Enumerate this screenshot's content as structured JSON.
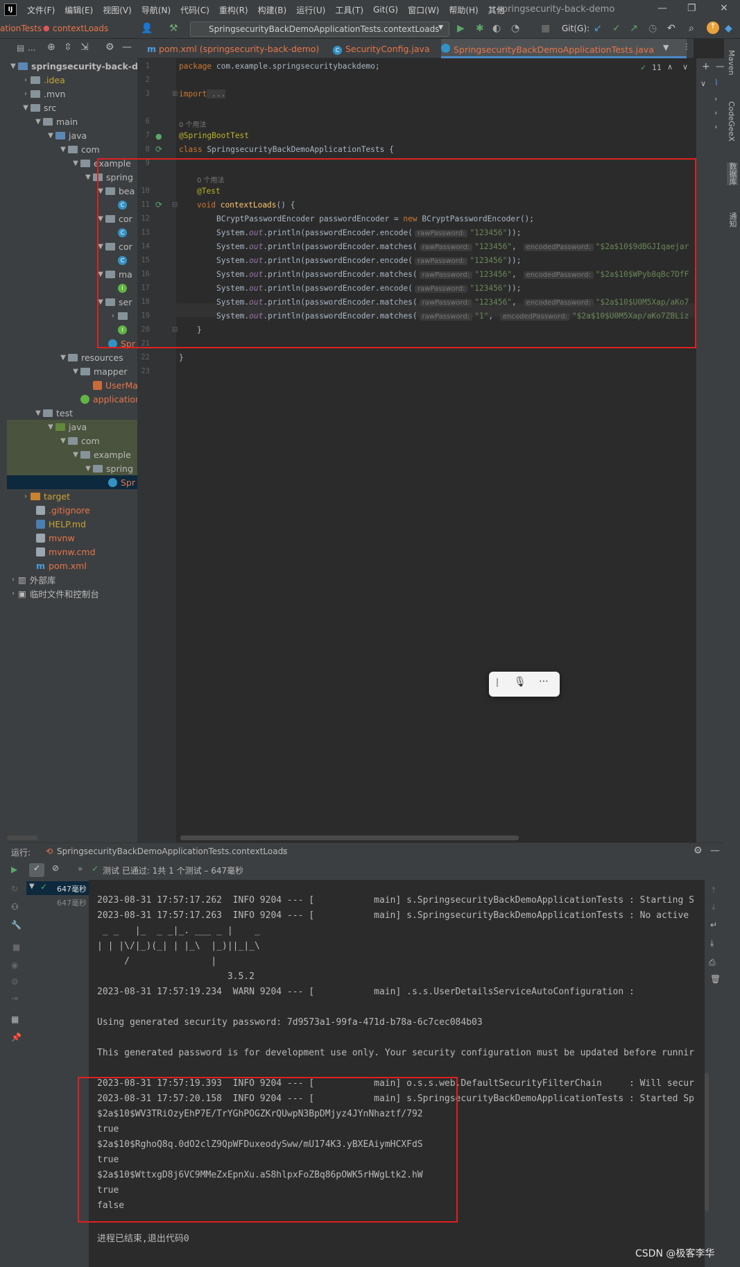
{
  "menubar": {
    "logo": "IJ",
    "items": [
      "文件(F)",
      "编辑(E)",
      "视图(V)",
      "导航(N)",
      "代码(C)",
      "重构(R)",
      "构建(B)",
      "运行(U)",
      "工具(T)",
      "Git(G)",
      "窗口(W)",
      "帮助(H)",
      "其他"
    ],
    "title": "springsecurity-back-demo"
  },
  "toolbar": {
    "crumb1": "ationTests",
    "crumb2": "contextLoads",
    "run_config": "SpringsecurityBackDemoApplicationTests.contextLoads",
    "git": "Git(G):"
  },
  "tabs": [
    {
      "label": "pom.xml (springsecurity-back-demo)"
    },
    {
      "label": "SecurityConfig.java"
    },
    {
      "label": "SpringsecurityBackDemoApplicationTests.java"
    }
  ],
  "project": {
    "header": "...",
    "nodes": [
      "springsecurity-back-demo",
      ".idea",
      ".mvn",
      "src",
      "main",
      "java",
      "com",
      "example",
      "spring",
      "bea",
      "C",
      "cor",
      "C",
      "cor",
      "C",
      "ma",
      "I",
      "ser",
      "",
      "I",
      "Spr",
      "resources",
      "mapper",
      "UserMap",
      "application.p",
      "test",
      "java",
      "com",
      "example",
      "spring",
      "Spr",
      "target",
      ".gitignore",
      "HELP.md",
      "mvnw",
      "mvnw.cmd",
      "pom.xml",
      "外部库",
      "临时文件和控制台"
    ]
  },
  "editor": {
    "lines": [
      "1",
      "2",
      "3",
      "6",
      "7",
      "8",
      "9",
      "10",
      "11",
      "12",
      "13",
      "14",
      "15",
      "16",
      "17",
      "18",
      "19",
      "20",
      "21",
      "22",
      "23"
    ],
    "usage1": "0 个用法",
    "usage2": "0 个用法",
    "warnings": "11",
    "code": {
      "l1a": "package",
      "l1b": " com.example.springsecuritybackdemo;",
      "l3a": "import",
      "l3b": " ...",
      "l7": "@SpringBootTest",
      "l8a": "class",
      "l8b": " SpringsecurityBackDemoApplicationTests {",
      "l10": "@Test",
      "l11a": "void",
      "l11b": "contextLoads",
      "l11c": "() {",
      "l12a": "BCryptPasswordEncoder passwordEncoder = ",
      "l12b": "new",
      "l12c": " BCryptPasswordEncoder();",
      "sys": "System.",
      "out": "out",
      "println_encode": ".println(passwordEncoder.encode(",
      "println_matches": ".println(passwordEncoder.matches(",
      "raw": "rawPassword:",
      "enc": "encodedPassword:",
      "s123456": "\"123456\"",
      "s1": "\"1\"",
      "close": "));",
      "comma": ",",
      "h14": "\"$2a$10$9dBGJIqaejar",
      "h16": "\"$2a$10$WPyb8qBc7DfF",
      "h18": "\"$2a$10$U0M5Xap/aKo7",
      "h19": "\"$2a$10$U0M5Xap/aKo7ZBLiz",
      "l20": "}",
      "l22": "}"
    }
  },
  "run": {
    "label": "运行:",
    "tab": "SpringsecurityBackDemoApplicationTests.contextLoads",
    "status": "测试 已通过: 1共 1 个测试 – 647毫秒",
    "tree1": "647毫秒",
    "tree2": "647毫秒",
    "console": [
      "2023-08-31 17:57:17.262  INFO 9204 --- [           main] s.SpringsecurityBackDemoApplicationTests : Starting S",
      "2023-08-31 17:57:17.263  INFO 9204 --- [           main] s.SpringsecurityBackDemoApplicationTests : No active",
      " _ _   |_  _ _|_. ___ _ |    _",
      "| | |\\/|_)(_| | |_\\  |_)||_|_\\",
      "     /               |",
      "                        3.5.2",
      "2023-08-31 17:57:19.234  WARN 9204 --- [           main] .s.s.UserDetailsServiceAutoConfiguration :",
      "",
      "Using generated security password: 7d9573a1-99fa-471d-b78a-6c7cec084b03",
      "",
      "This generated password is for development use only. Your security configuration must be updated before runnir",
      "",
      "2023-08-31 17:57:19.393  INFO 9204 --- [           main] o.s.s.web.DefaultSecurityFilterChain     : Will secur",
      "2023-08-31 17:57:20.158  INFO 9204 --- [           main] s.SpringsecurityBackDemoApplicationTests : Started Sp",
      "$2a$10$WV3TRiOzyEhP7E/TrYGhPOGZKrQUwpN3BpDMjyz4JYnNhaztf/792",
      "true",
      "$2a$10$RghoQ8q.0dO2clZ9QpWFDuxeodySww/mU174K3.yBXEAiymHCXFdS",
      "true",
      "$2a$10$WttxgD8j6VC9MMeZxEpnXu.aS8hlpxFoZBq86pOWK5rHWgLtk2.hW",
      "true",
      "false",
      "",
      "进程已结束,退出代码0"
    ]
  },
  "right": {
    "maven": "Maven",
    "codegeex": "CodeGeeX",
    "db": "数据库",
    "notify": "通知"
  },
  "watermark": "CSDN @极客李华",
  "colors": {
    "keyword": "#cc7832",
    "annotation": "#bbb529",
    "string": "#6a8759",
    "method": "#ffc66d",
    "field": "#9876aa",
    "text": "#a9b7c6",
    "highlight": "#e02020"
  }
}
